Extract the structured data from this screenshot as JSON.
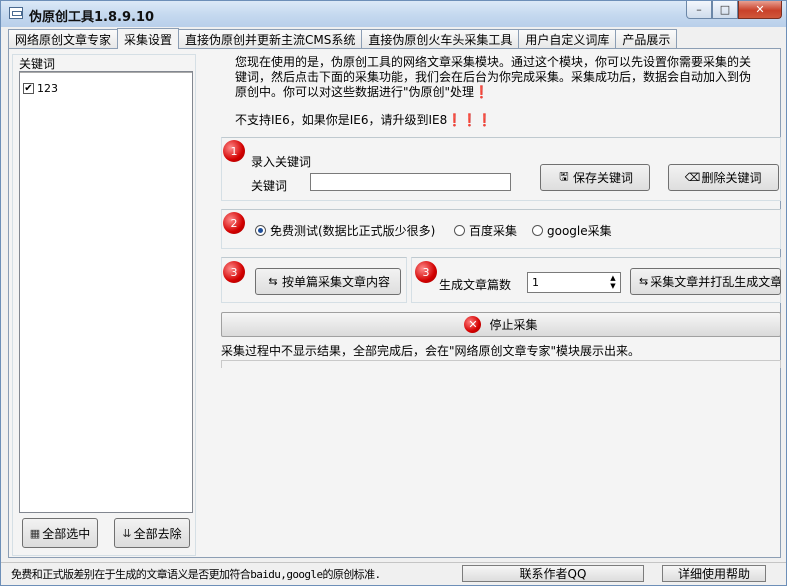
{
  "window": {
    "title": "伪原创工具1.8.9.10",
    "minimize": "–",
    "maximize": "□",
    "close": "✕"
  },
  "tabs": [
    {
      "label": "网络原创文章专家"
    },
    {
      "label": "采集设置"
    },
    {
      "label": "直接伪原创并更新主流CMS系统"
    },
    {
      "label": "直接伪原创火车头采集工具"
    },
    {
      "label": "用户自定义词库"
    },
    {
      "label": "产品展示"
    }
  ],
  "keywords": {
    "legend": "关键词",
    "items": [
      {
        "label": "123",
        "checked": true
      }
    ],
    "select_all": "全部选中",
    "remove_all": "全部去除"
  },
  "intro": "您现在使用的是，伪原创工具的网络文章采集模块。通过这个模块，你可以先设置你需要采集的关键词，然后点击下面的采集功能，我们会在后台为你完成采集。采集成功后，数据会自动加入到伪原创中。你可以对这些数据进行\"伪原创\"处理❗",
  "note": "不支持IE6，如果你是IE6，请升级到IE8❗❗❗",
  "step1": {
    "badge": "1",
    "heading": "录入关键词",
    "label": "关键词",
    "value": "",
    "save": "保存关键词",
    "delete": "删除关键词"
  },
  "step2": {
    "badge": "2",
    "options": [
      "免费测试(数据比正式版少很多)",
      "百度采集",
      "google采集"
    ],
    "selected": "免费测试(数据比正式版少很多)"
  },
  "step3": {
    "badge_a": "3",
    "single": "按单篇采集文章内容",
    "badge_b": "3",
    "count_label": "生成文章篇数",
    "count": "1",
    "collect_shuffle": "采集文章并打乱生成文章"
  },
  "stop": "停止采集",
  "process_note": "采集过程中不显示结果，全部完成后，会在\"网络原创文章专家\"模块展示出来。",
  "status": {
    "text": "免费和正式版差别在于生成的文章语义是否更加符合baidu,google的原创标准.",
    "contact": "联系作者QQ",
    "help": "详细使用帮助"
  }
}
